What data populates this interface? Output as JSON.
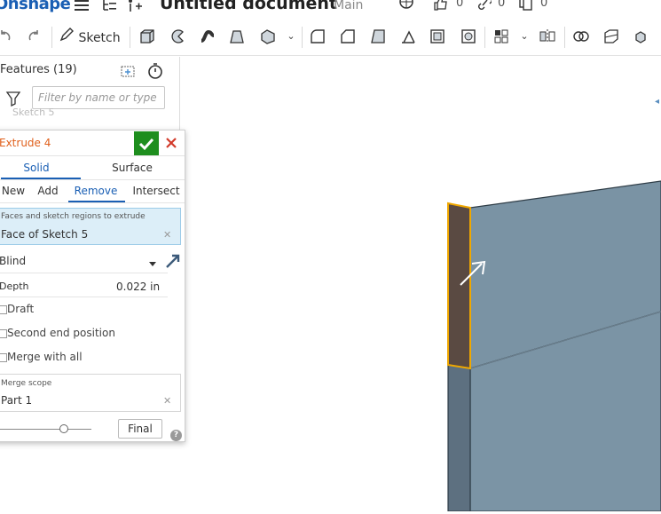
{
  "app": {
    "logo_text": "Onshape",
    "document_title": "Untitled document",
    "branch": "Main",
    "likes": "0",
    "links": "0",
    "copies": "0"
  },
  "toolbar": {
    "sketch_label": "Sketch"
  },
  "feature_list": {
    "title": "Features (19)",
    "filter_placeholder": "Filter by name or type",
    "hidden_item": "Sketch 5"
  },
  "extrude_dialog": {
    "title": "Extrude 4",
    "type_tabs": [
      "Solid",
      "Surface"
    ],
    "active_type": "Solid",
    "operation_tabs": [
      "New",
      "Add",
      "Remove",
      "Intersect"
    ],
    "active_operation": "Remove",
    "faces_label": "Faces and sketch regions to extrude",
    "faces_value": "Face of Sketch 5",
    "end_type": "Blind",
    "depth_label": "Depth",
    "depth_value": "0.022 in",
    "draft_label": "Draft",
    "second_end_label": "Second end position",
    "merge_all_label": "Merge with all",
    "merge_scope_label": "Merge scope",
    "merge_scope_value": "Part 1",
    "final_label": "Final",
    "help": "?"
  },
  "colors": {
    "accent": "#1a5fb4",
    "dialog_title": "#e0601c",
    "accept": "#1e8e1e",
    "cancel": "#d23a2a",
    "part_face": "#7a93a4",
    "selected_face": "#5a4a42",
    "highlight": "#f0a800"
  }
}
